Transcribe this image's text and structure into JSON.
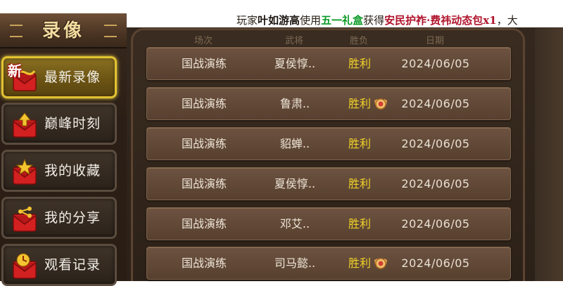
{
  "announcement": {
    "prefix": "玩家",
    "player": "叶如游高",
    "verb": "使用",
    "item": "五一礼盒",
    "got": "获得",
    "reward": "安民护祚·费祎动态包x1",
    "tail": "，大"
  },
  "panel": {
    "title": "录像"
  },
  "menu": [
    {
      "label": "最新录像",
      "icon": "new-red-envelope-icon",
      "active": true,
      "badge": "新"
    },
    {
      "label": "巅峰时刻",
      "icon": "red-envelope-up-arrow-icon",
      "active": false
    },
    {
      "label": "我的收藏",
      "icon": "red-envelope-star-icon",
      "active": false
    },
    {
      "label": "我的分享",
      "icon": "red-envelope-share-icon",
      "active": false
    },
    {
      "label": "观看记录",
      "icon": "red-envelope-clock-icon",
      "active": false
    }
  ],
  "table": {
    "headers": [
      "场次",
      "武将",
      "胜负",
      "日期"
    ],
    "rows": [
      {
        "mode": "国战演练",
        "general": "夏侯惇..",
        "result": "胜利",
        "date": "2024/06/05",
        "badge": false
      },
      {
        "mode": "国战演练",
        "general": "鲁肃..",
        "result": "胜利",
        "date": "2024/06/05",
        "badge": true
      },
      {
        "mode": "国战演练",
        "general": "貂蝉..",
        "result": "胜利",
        "date": "2024/06/05",
        "badge": false
      },
      {
        "mode": "国战演练",
        "general": "夏侯惇..",
        "result": "胜利",
        "date": "2024/06/05",
        "badge": false
      },
      {
        "mode": "国战演练",
        "general": "邓艾..",
        "result": "胜利",
        "date": "2024/06/05",
        "badge": false
      },
      {
        "mode": "国战演练",
        "general": "司马懿..",
        "result": "胜利",
        "date": "2024/06/05",
        "badge": true
      }
    ]
  },
  "colors": {
    "result": "#f0d228",
    "active_border": "#e2c232",
    "announce_item": "#0a9a25",
    "announce_reward": "#b0132b"
  }
}
